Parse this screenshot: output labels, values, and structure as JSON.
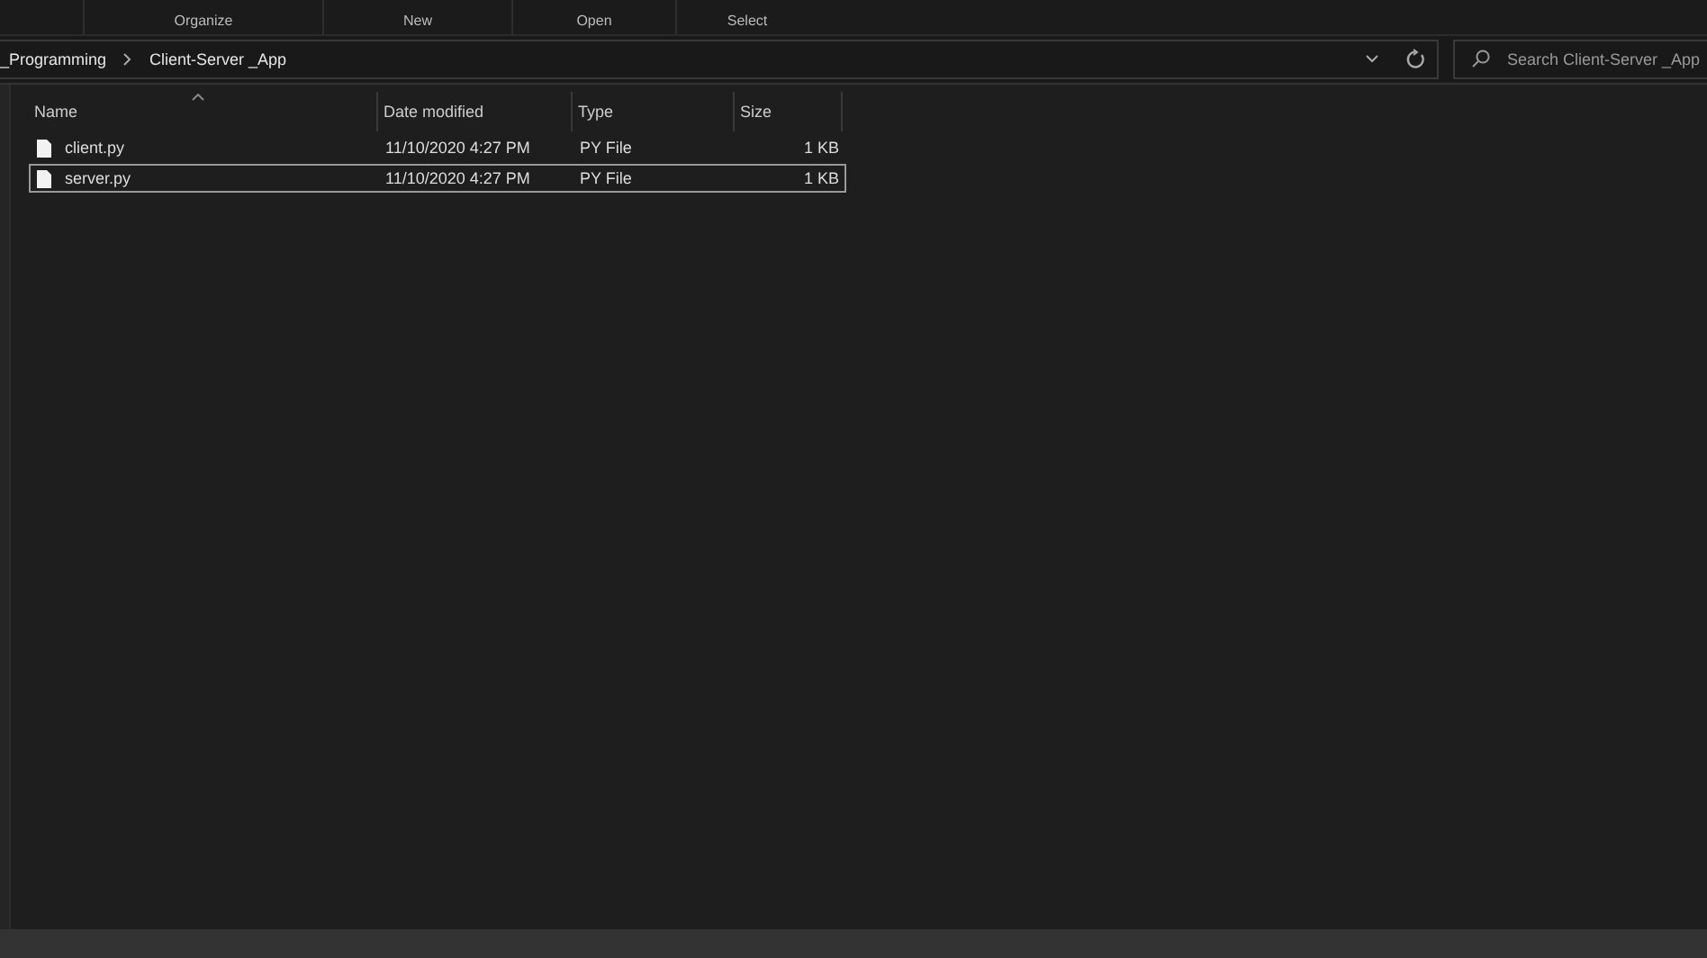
{
  "ribbon": {
    "groups": [
      "Organize",
      "New",
      "Open",
      "Select"
    ]
  },
  "address_bar": {
    "path": [
      "_Programming",
      "Client-Server _App"
    ]
  },
  "search": {
    "placeholder": "Search Client-Server _App"
  },
  "table": {
    "columns": [
      "Name",
      "Date modified",
      "Type",
      "Size"
    ],
    "rows": [
      {
        "name": "client.py",
        "date": "11/10/2020 4:27 PM",
        "type": "PY File",
        "size": "1 KB",
        "selected": false
      },
      {
        "name": "server.py",
        "date": "11/10/2020 4:27 PM",
        "type": "PY File",
        "size": "1 KB",
        "selected": true
      }
    ]
  }
}
